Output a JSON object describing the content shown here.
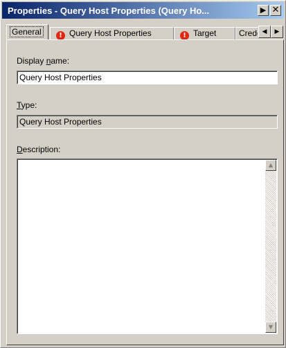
{
  "window": {
    "title": "Properties - Query Host Properties (Query Ho...",
    "arrow_icon": "▶",
    "close_icon": "✕"
  },
  "tabs": {
    "general": "General",
    "query_host_properties": "Query Host Properties",
    "target": "Target",
    "credentials": "Crede",
    "warning_icon": "!",
    "scroll_left_icon": "◀",
    "scroll_right_icon": "▶"
  },
  "form": {
    "display_name_label_pre": "Display ",
    "display_name_label_key": "n",
    "display_name_label_post": "ame:",
    "display_name_value": "Query Host Properties",
    "type_label_key": "T",
    "type_label_post": "ype:",
    "type_value": "Query Host Properties",
    "description_label_key": "D",
    "description_label_post": "escription:",
    "description_value": ""
  },
  "scrollbar": {
    "up_icon": "▲",
    "down_icon": "▼"
  },
  "colors": {
    "title_gradient_start": "#0a246a",
    "title_gradient_end": "#a6caf0",
    "face": "#d4d0c8",
    "warning": "#e02810"
  }
}
